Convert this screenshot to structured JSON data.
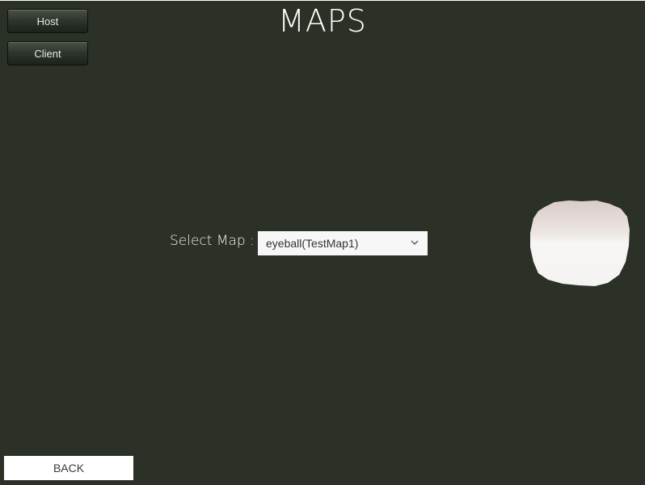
{
  "menu": {
    "host_label": "Host",
    "client_label": "Client"
  },
  "page": {
    "title": "MAPS"
  },
  "map_select": {
    "label": "Select Map :",
    "selected_value": "eyeball(TestMap1)",
    "icon": "chevron-down-icon"
  },
  "preview": {
    "icon": "map-preview-image"
  },
  "footer": {
    "back_label": "BACK"
  },
  "colors": {
    "background": "#2b3126",
    "text": "#ffffff",
    "dropdown_bg": "#f7f7f7",
    "back_button_bg": "#ffffff"
  }
}
